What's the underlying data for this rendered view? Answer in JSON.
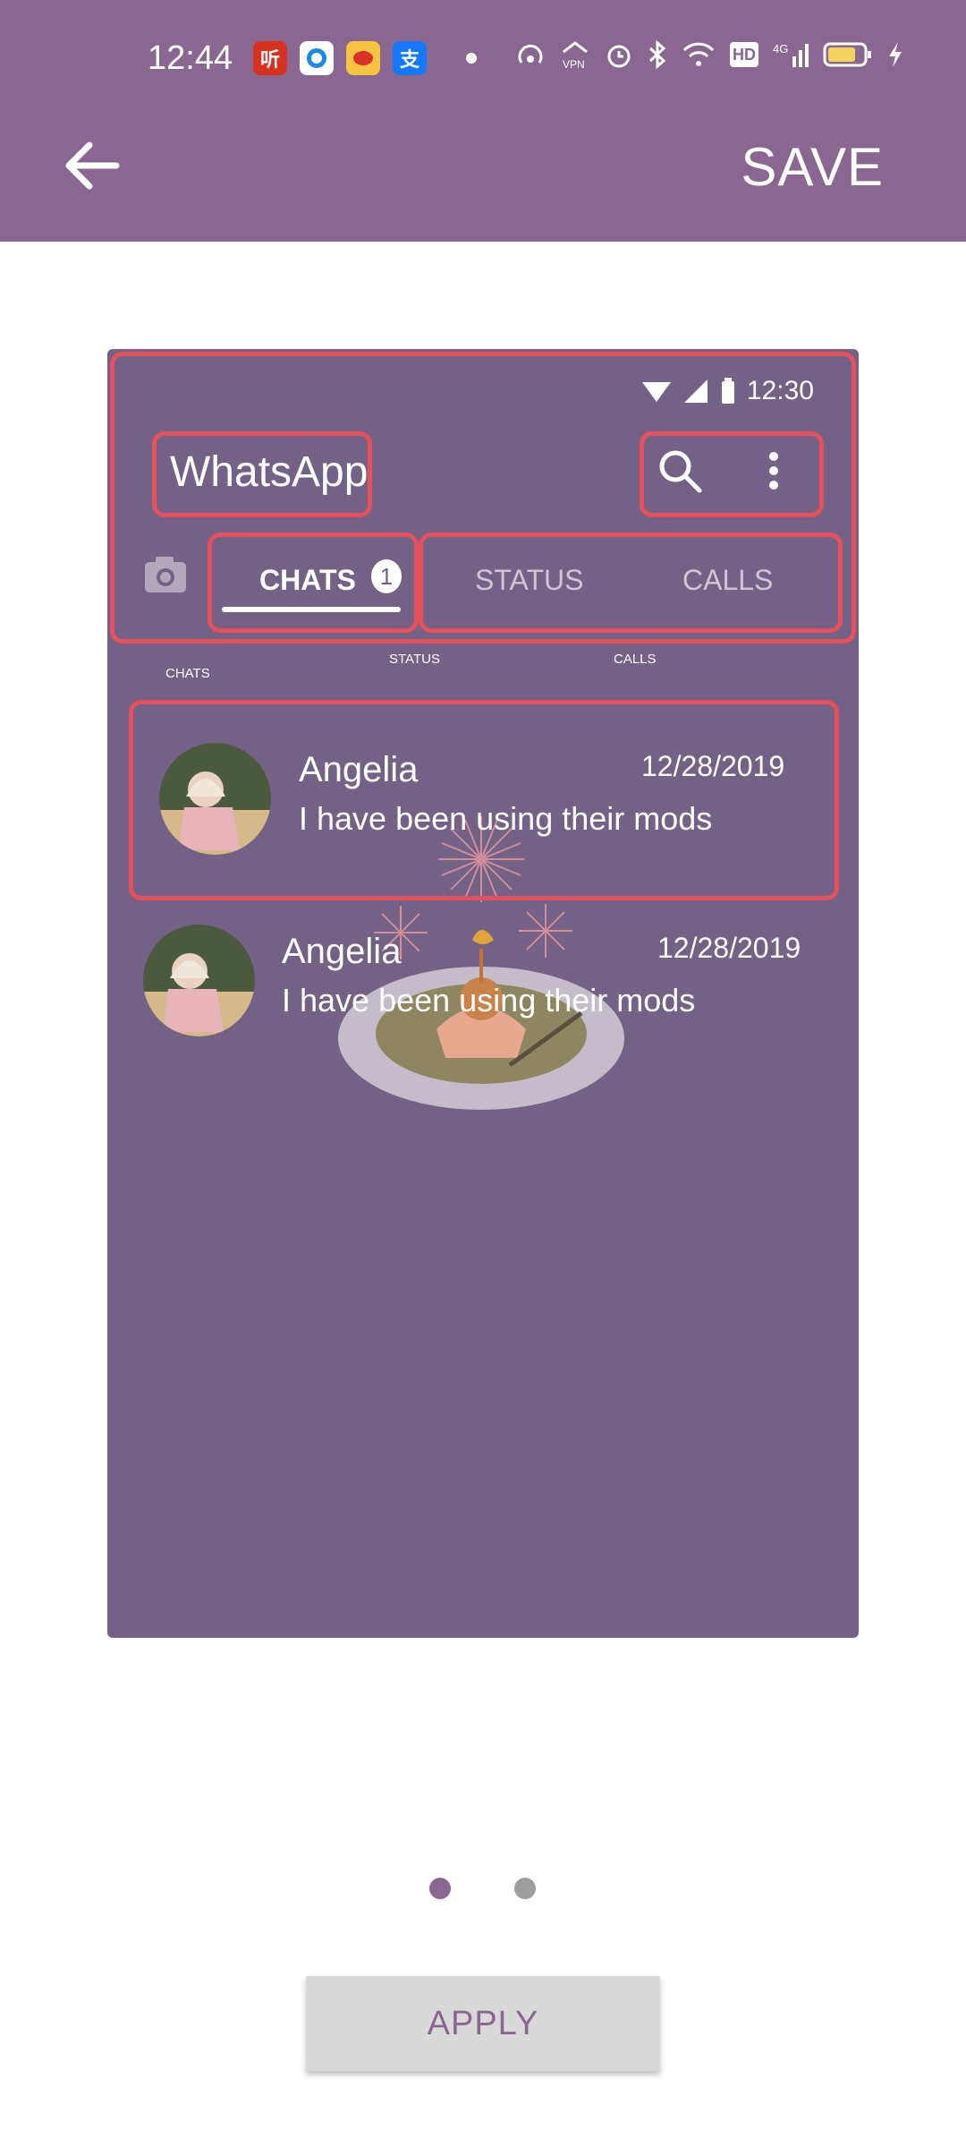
{
  "status_bar": {
    "time": "12:44",
    "icons": [
      "listen-app-icon",
      "circle-app-icon",
      "weibo-icon",
      "alipay-icon",
      "hotspot-icon",
      "vpn-icon",
      "alarm-icon",
      "bluetooth-icon",
      "wifi-icon",
      "hd-icon",
      "4g-signal-icon",
      "battery-icon",
      "charging-icon"
    ]
  },
  "header": {
    "back_icon": "arrow-left-icon",
    "save_label": "SAVE",
    "color": "#8a6790"
  },
  "preview": {
    "time": "12:30",
    "app_title": "WhatsApp",
    "tabs": {
      "chats": "CHATS",
      "badge": "1",
      "status": "STATUS",
      "calls": "CALLS"
    },
    "mini_labels": {
      "chats": "CHATS",
      "status": "STATUS",
      "calls": "CALLS"
    },
    "chats": [
      {
        "name": "Angelia",
        "date": "12/28/2019",
        "message": "I have been using their mods"
      },
      {
        "name": "Angelia",
        "date": "12/28/2019",
        "message": "I have been using their mods"
      }
    ],
    "background_color": "#736285",
    "highlight_color": "#e5505c"
  },
  "pager": {
    "active_color": "#8a6790",
    "inactive_color": "#9e9e9e"
  },
  "apply_label": "APPLY"
}
